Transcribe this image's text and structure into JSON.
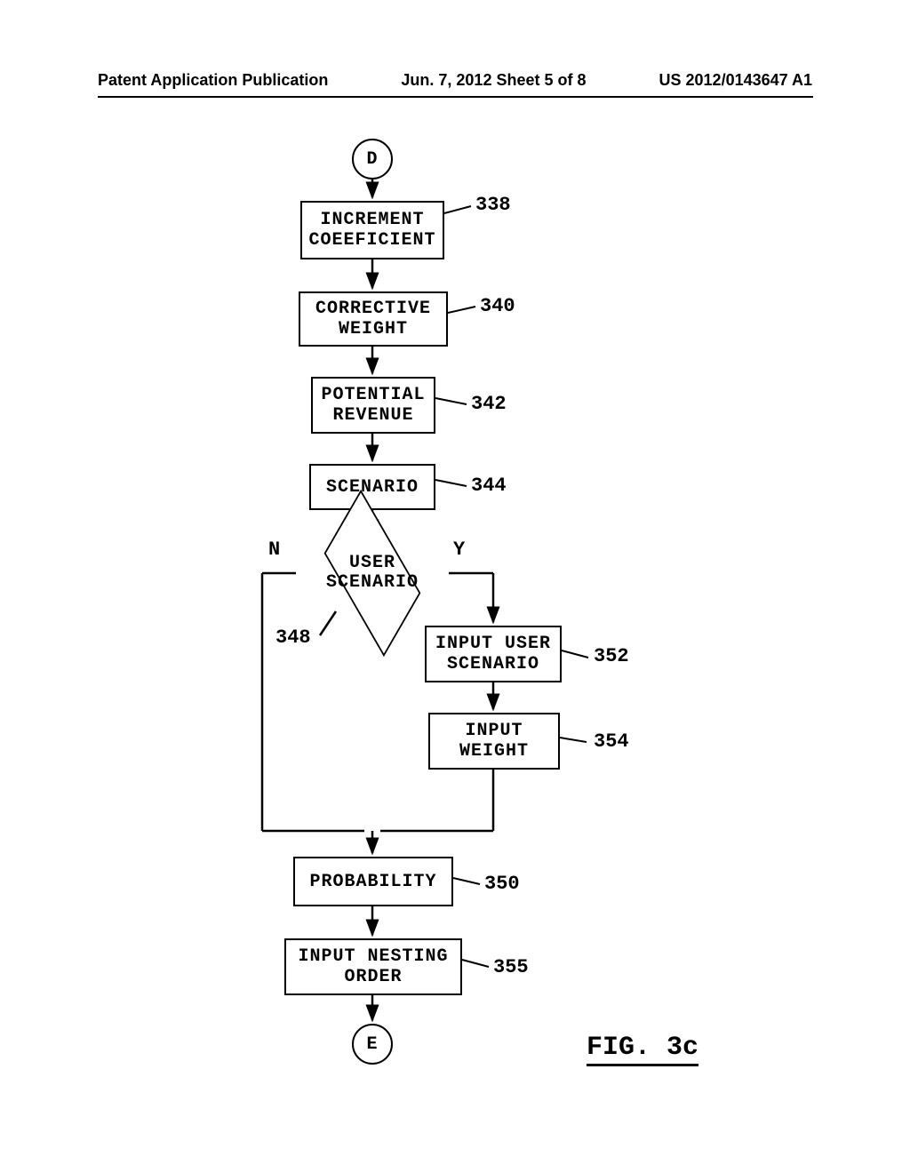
{
  "header": {
    "left": "Patent Application Publication",
    "center": "Jun. 7, 2012  Sheet 5 of 8",
    "right": "US 2012/0143647 A1"
  },
  "nodes": {
    "start": "D",
    "n338": "INCREMENT\nCOEEFICIENT",
    "n340": "CORRECTIVE\nWEIGHT",
    "n342": "POTENTIAL\nREVENUE",
    "n344": "SCENARIO",
    "n348": "USER\nSCENARIO",
    "n352": "INPUT USER\nSCENARIO",
    "n354": "INPUT\nWEIGHT",
    "n350": "PROBABILITY",
    "n355": "INPUT NESTING\nORDER",
    "end": "E"
  },
  "labels": {
    "r338": "338",
    "r340": "340",
    "r342": "342",
    "r344": "344",
    "r348": "348",
    "r352": "352",
    "r354": "354",
    "r350": "350",
    "r355": "355"
  },
  "branches": {
    "no": "N",
    "yes": "Y"
  },
  "figure": "FIG. 3c"
}
